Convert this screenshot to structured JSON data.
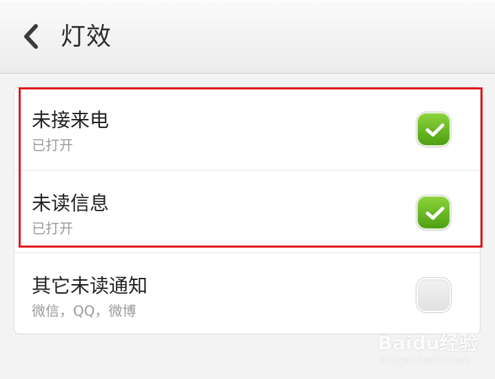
{
  "header": {
    "title": "灯效",
    "back_icon": "chevron-left-icon"
  },
  "settings": {
    "items": [
      {
        "title": "未接来电",
        "subtitle": "已打开",
        "checked": true
      },
      {
        "title": "未读信息",
        "subtitle": "已打开",
        "checked": true
      },
      {
        "title": "其它未读通知",
        "subtitle": "微信，QQ，微博",
        "checked": false
      }
    ]
  },
  "watermark": {
    "brand": "Baidu经验",
    "url": "jingyan.baidu.com"
  },
  "colors": {
    "checkbox_on": "#5bb11d",
    "highlight": "#e0161b",
    "background": "#f3f3f3"
  }
}
